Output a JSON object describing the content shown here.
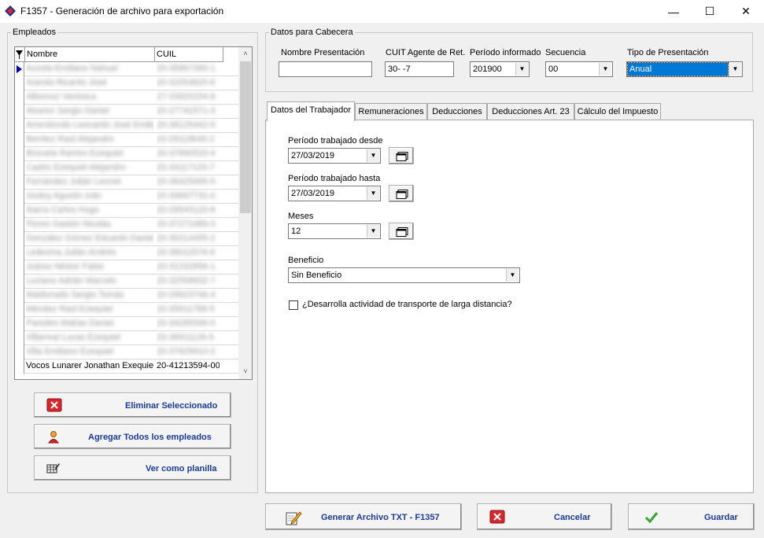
{
  "window": {
    "title": "F1357 - Generación de archivo para exportación",
    "minimize_glyph": "—",
    "maximize_glyph": "☐",
    "close_glyph": "✕"
  },
  "employees": {
    "legend": "Empleados",
    "columns": [
      "Nombre",
      "CUIL"
    ],
    "rows": [
      {
        "name": "Acosta Emiliano Nahuel",
        "cuil": "20-35867390-1",
        "blurred": true
      },
      {
        "name": "Aranda Ricardo José",
        "cuil": "20-31554820-6",
        "blurred": true
      },
      {
        "name": "Albornoz Verónica",
        "cuil": "27-33920154-8",
        "blurred": true
      },
      {
        "name": "Alvarez Sergio Daniel",
        "cuil": "20-27741571-3",
        "blurred": true
      },
      {
        "name": "Arrendondo Leonardo José Emiliano",
        "cuil": "20-38125442-9",
        "blurred": true
      },
      {
        "name": "Benítez Raúl Alejandro",
        "cuil": "20-29118640-2",
        "blurred": true
      },
      {
        "name": "Brizuela Ramiro Ezequiel",
        "cuil": "20-37890533-4",
        "blurred": true
      },
      {
        "name": "Castro Ezequiel Alejandro",
        "cuil": "20-34117120-7",
        "blurred": true
      },
      {
        "name": "Fernández Julián Leonel",
        "cuil": "20-36425995-5",
        "blurred": true
      },
      {
        "name": "Godoy Agustín Iván",
        "cuil": "20-39667731-0",
        "blurred": true
      },
      {
        "name": "Ibarra Carlos Hugo",
        "cuil": "20-28543120-8",
        "blurred": true
      },
      {
        "name": "Flores Gastón Nicolás",
        "cuil": "20-37271989-3",
        "blurred": true
      },
      {
        "name": "González Gómez Eduardo Daniel",
        "cuil": "20-30214455-2",
        "blurred": true
      },
      {
        "name": "Ledesma Julián Andrés",
        "cuil": "20-38012576-6",
        "blurred": true
      },
      {
        "name": "Juárez Néstor Fabio",
        "cuil": "20-31332856-1",
        "blurred": true
      },
      {
        "name": "Luciano Adrián Marcelo",
        "cuil": "20-32558832-7",
        "blurred": true
      },
      {
        "name": "Maldonado Sergio Tomás",
        "cuil": "20-29923746-4",
        "blurred": true
      },
      {
        "name": "Méndez Raúl Ezequiel",
        "cuil": "20-35611788-9",
        "blurred": true
      },
      {
        "name": "Paredes Matías Daniel",
        "cuil": "20-34285566-0",
        "blurred": true
      },
      {
        "name": "Villarreal Lucas Ezequiel",
        "cuil": "20-36911126-5",
        "blurred": true
      },
      {
        "name": "Villa Emiliano Ezequiel",
        "cuil": "20-37629910-2",
        "blurred": true
      },
      {
        "name": "Vocos Lunarer Jonathan Exequiel",
        "cuil": "20-41213594-00",
        "blurred": false
      }
    ],
    "delete_button": "Eliminar Seleccionado",
    "add_all_button": "Agregar Todos los empleados",
    "view_sheet_button": "Ver como planilla"
  },
  "header": {
    "legend": "Datos para Cabecera",
    "presentation_name_label": "Nombre Presentación",
    "presentation_name_value": "",
    "cuit_label": "CUIT Agente de Ret.",
    "cuit_value": "30-           -7",
    "period_label": "Período informado",
    "period_value": "201900",
    "sequence_label": "Secuencia",
    "sequence_value": "00",
    "type_label": "Tipo de Presentación",
    "type_value": "Anual"
  },
  "tabs": [
    {
      "label": "Datos del Trabajador",
      "active": true
    },
    {
      "label": "Remuneraciones",
      "active": false
    },
    {
      "label": "Deducciones",
      "active": false
    },
    {
      "label": "Deducciones Art. 23",
      "active": false
    },
    {
      "label": "Cálculo del Impuesto",
      "active": false
    }
  ],
  "worker": {
    "period_from_label": "Período trabajado desde",
    "period_from_value": "27/03/2019",
    "period_to_label": "Período trabajado hasta",
    "period_to_value": "27/03/2019",
    "months_label": "Meses",
    "months_value": "12",
    "benefit_label": "Beneficio",
    "benefit_value": "Sin Beneficio",
    "long_distance_label": "¿Desarrolla actividad de transporte de larga distancia?",
    "long_distance_checked": false
  },
  "footer": {
    "generate_button": "Generar Archivo TXT - F1357",
    "cancel_button": "Cancelar",
    "save_button": "Guardar"
  },
  "colors": {
    "selection": "#0078d7",
    "button_text": "#1a3a9c",
    "cancel_red": "#d8262b",
    "ok_green": "#3aa335"
  }
}
